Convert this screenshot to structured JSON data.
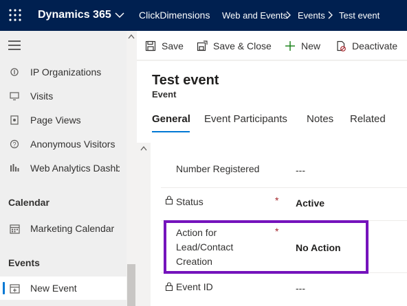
{
  "topbar": {
    "app_name": "Dynamics 365",
    "crumbs": [
      "ClickDimensions",
      "Web and Events",
      "Events",
      "Test event"
    ]
  },
  "sidebar": {
    "items": [
      {
        "label": "IP Organizations",
        "icon": "ip-organization-icon"
      },
      {
        "label": "Visits",
        "icon": "monitor-icon"
      },
      {
        "label": "Page Views",
        "icon": "page-view-icon"
      },
      {
        "label": "Anonymous Visitors",
        "icon": "anonymous-visitor-icon"
      },
      {
        "label": "Web Analytics Dashboard",
        "icon": "analytics-icon"
      }
    ],
    "sections": [
      {
        "title": "Calendar",
        "items": [
          {
            "label": "Marketing Calendar",
            "icon": "calendar-icon"
          }
        ]
      },
      {
        "title": "Events",
        "items": [
          {
            "label": "New Event",
            "icon": "new-event-icon",
            "active": true
          }
        ]
      }
    ]
  },
  "commands": {
    "save": "Save",
    "save_close": "Save & Close",
    "new": "New",
    "deactivate": "Deactivate"
  },
  "record": {
    "title": "Test event",
    "entity": "Event",
    "tabs": [
      "General",
      "Event Participants",
      "Notes",
      "Related"
    ],
    "active_tab": "General"
  },
  "form": {
    "fields": [
      {
        "label": "Number Registered",
        "value": "---",
        "locked": false,
        "required": false
      },
      {
        "label": "Status",
        "value": "Active",
        "locked": true,
        "required": true
      },
      {
        "label": "Action for Lead/Contact Creation",
        "value": "No Action",
        "locked": false,
        "required": true,
        "highlighted": true
      },
      {
        "label": "Event ID",
        "value": "---",
        "locked": true,
        "required": false
      }
    ],
    "required_marker": "*"
  },
  "colors": {
    "topbar": "#002050",
    "accent": "#0078d4",
    "highlight": "#7513bc",
    "required": "#a4262c"
  }
}
